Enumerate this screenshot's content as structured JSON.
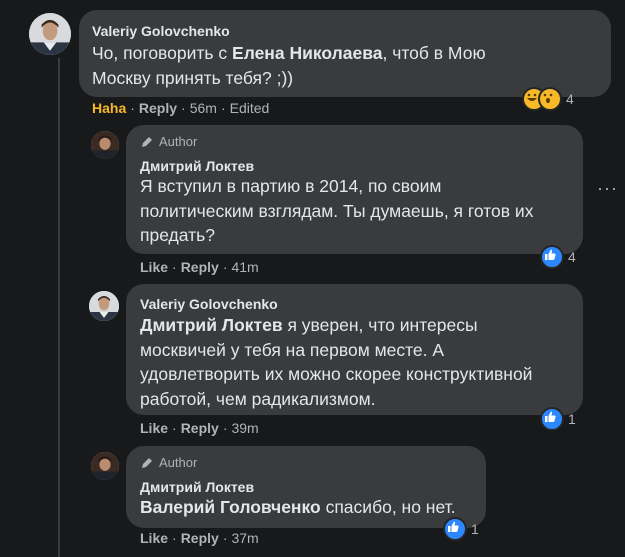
{
  "comments": [
    {
      "name": "Valeriy Golovchenko",
      "text_line1_pre": "Чо, поговорить с ",
      "text_line1_bold": "Елена Николаева",
      "text_line1_post": ", чтоб в Мою",
      "text_line2": "Москву принять тебя? ;))",
      "reaction_label": "Haha",
      "reply_label": "Reply",
      "time": "56m",
      "edited": "Edited",
      "reaction_count": "4"
    },
    {
      "author_badge": "Author",
      "name": "Дмитрий Локтев",
      "text_line1": "Я вступил в партию в 2014, по своим",
      "text_line2": "политическим взглядам. Ты думаешь, я готов их",
      "text_line3": "предать?",
      "like_label": "Like",
      "reply_label": "Reply",
      "time": "41m",
      "reaction_count": "4"
    },
    {
      "name": "Valeriy Golovchenko",
      "text_line1_bold": "Дмитрий Локтев",
      "text_line1_post": " я уверен, что интересы",
      "text_line2": "москвичей у тебя на первом месте. А",
      "text_line3": "удовлетворить их можно скорее конструктивной",
      "text_line4": "работой, чем радикализмом.",
      "like_label": "Like",
      "reply_label": "Reply",
      "time": "39m",
      "reaction_count": "1"
    },
    {
      "author_badge": "Author",
      "name": "Дмитрий Локтев",
      "text_bold": "Валерий Головченко",
      "text_post": " спасибо, но нет.",
      "like_label": "Like",
      "reply_label": "Reply",
      "time": "37m",
      "reaction_count": "1"
    }
  ],
  "colors": {
    "background": "#18191a",
    "bubble": "#3a3b3c",
    "text": "#e4e6eb",
    "secondary": "#b0b3b8",
    "haha": "#f7b928",
    "like": "#2d88ff"
  }
}
